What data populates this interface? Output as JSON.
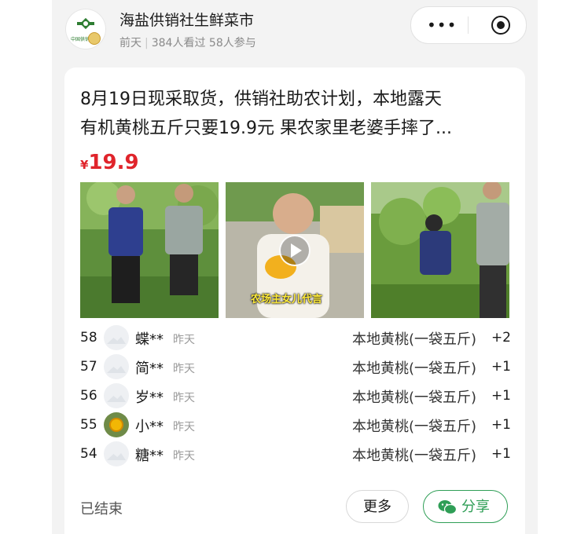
{
  "header": {
    "shop_name": "海盐供销社生鲜菜市",
    "posted": "前天",
    "views": "384人看过",
    "participants": "58人参与",
    "logo_text": "中国供销",
    "more_icon": "more-dots-icon",
    "close_icon": "target-circle-icon"
  },
  "post": {
    "title_line1": "8月19日现采取货，供销社助农计划，本地露天",
    "title_line2": "有机黄桃五斤只要19.9元 果农家里老婆手摔了...",
    "price_symbol": "¥",
    "price_value": "19.9",
    "photo_caption": "农场主女儿代言"
  },
  "orders": [
    {
      "no": "58",
      "name": "蝶**",
      "time": "昨天",
      "item": "本地黄桃(一袋五斤)",
      "qty": "+2"
    },
    {
      "no": "57",
      "name": "简**",
      "time": "昨天",
      "item": "本地黄桃(一袋五斤)",
      "qty": "+1"
    },
    {
      "no": "56",
      "name": "岁**",
      "time": "昨天",
      "item": "本地黄桃(一袋五斤)",
      "qty": "+1"
    },
    {
      "no": "55",
      "name": "小**",
      "time": "昨天",
      "item": "本地黄桃(一袋五斤)",
      "qty": "+1"
    },
    {
      "no": "54",
      "name": "糖**",
      "time": "昨天",
      "item": "本地黄桃(一袋五斤)",
      "qty": "+1"
    }
  ],
  "footer": {
    "status": "已结束",
    "more_label": "更多",
    "share_label": "分享"
  },
  "colors": {
    "price_red": "#e0242b",
    "wechat_green": "#2f9e56"
  }
}
